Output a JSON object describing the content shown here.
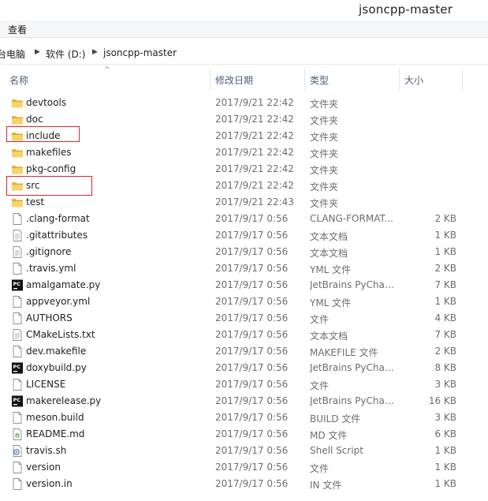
{
  "window": {
    "title": "jsoncpp-master"
  },
  "menu": {
    "view_label": "查看"
  },
  "breadcrumb": {
    "items": [
      "台电脑",
      "软件 (D:)",
      "jsoncpp-master"
    ],
    "separator": "▶"
  },
  "columns": {
    "name": "名称",
    "date": "修改日期",
    "type": "类型",
    "size": "大小"
  },
  "files": [
    {
      "name": "devtools",
      "date": "2017/9/21 22:42",
      "type": "文件夹",
      "size": "",
      "icon": "folder-icon"
    },
    {
      "name": "doc",
      "date": "2017/9/21 22:42",
      "type": "文件夹",
      "size": "",
      "icon": "folder-icon"
    },
    {
      "name": "include",
      "date": "2017/9/21 22:42",
      "type": "文件夹",
      "size": "",
      "icon": "folder-icon"
    },
    {
      "name": "makefiles",
      "date": "2017/9/21 22:42",
      "type": "文件夹",
      "size": "",
      "icon": "folder-icon"
    },
    {
      "name": "pkg-config",
      "date": "2017/9/21 22:42",
      "type": "文件夹",
      "size": "",
      "icon": "folder-icon"
    },
    {
      "name": "src",
      "date": "2017/9/21 22:42",
      "type": "文件夹",
      "size": "",
      "icon": "folder-icon"
    },
    {
      "name": "test",
      "date": "2017/9/21 22:43",
      "type": "文件夹",
      "size": "",
      "icon": "folder-icon"
    },
    {
      "name": ".clang-format",
      "date": "2017/9/17 0:56",
      "type": "CLANG-FORMAT...",
      "size": "2 KB",
      "icon": "file-icon"
    },
    {
      "name": ".gitattributes",
      "date": "2017/9/17 0:56",
      "type": "文本文档",
      "size": "1 KB",
      "icon": "text-file-icon"
    },
    {
      "name": ".gitignore",
      "date": "2017/9/17 0:56",
      "type": "文本文档",
      "size": "1 KB",
      "icon": "text-file-icon"
    },
    {
      "name": ".travis.yml",
      "date": "2017/9/17 0:56",
      "type": "YML 文件",
      "size": "2 KB",
      "icon": "file-icon"
    },
    {
      "name": "amalgamate.py",
      "date": "2017/9/17 0:56",
      "type": "JetBrains PyChar...",
      "size": "7 KB",
      "icon": "pycharm-icon"
    },
    {
      "name": "appveyor.yml",
      "date": "2017/9/17 0:56",
      "type": "YML 文件",
      "size": "1 KB",
      "icon": "file-icon"
    },
    {
      "name": "AUTHORS",
      "date": "2017/9/17 0:56",
      "type": "文件",
      "size": "4 KB",
      "icon": "file-icon"
    },
    {
      "name": "CMakeLists.txt",
      "date": "2017/9/17 0:56",
      "type": "文本文档",
      "size": "7 KB",
      "icon": "text-file-icon"
    },
    {
      "name": "dev.makefile",
      "date": "2017/9/17 0:56",
      "type": "MAKEFILE 文件",
      "size": "2 KB",
      "icon": "file-icon"
    },
    {
      "name": "doxybuild.py",
      "date": "2017/9/17 0:56",
      "type": "JetBrains PyChar...",
      "size": "8 KB",
      "icon": "pycharm-icon"
    },
    {
      "name": "LICENSE",
      "date": "2017/9/17 0:56",
      "type": "文件",
      "size": "3 KB",
      "icon": "file-icon"
    },
    {
      "name": "makerelease.py",
      "date": "2017/9/17 0:56",
      "type": "JetBrains PyChar...",
      "size": "16 KB",
      "icon": "pycharm-icon"
    },
    {
      "name": "meson.build",
      "date": "2017/9/17 0:56",
      "type": "BUILD 文件",
      "size": "3 KB",
      "icon": "file-icon"
    },
    {
      "name": "README.md",
      "date": "2017/9/17 0:56",
      "type": "MD 文件",
      "size": "6 KB",
      "icon": "md-file-icon"
    },
    {
      "name": "travis.sh",
      "date": "2017/9/17 0:56",
      "type": "Shell Script",
      "size": "1 KB",
      "icon": "shell-script-icon"
    },
    {
      "name": "version",
      "date": "2017/9/17 0:56",
      "type": "文件",
      "size": "1 KB",
      "icon": "file-icon"
    },
    {
      "name": "version.in",
      "date": "2017/9/17 0:56",
      "type": "IN 文件",
      "size": "1 KB",
      "icon": "file-icon"
    }
  ],
  "highlighted": [
    "include",
    "src"
  ],
  "colors": {
    "highlight_border": "#d9272e",
    "folder": "#e8b93a",
    "header_text": "#4c607a"
  }
}
